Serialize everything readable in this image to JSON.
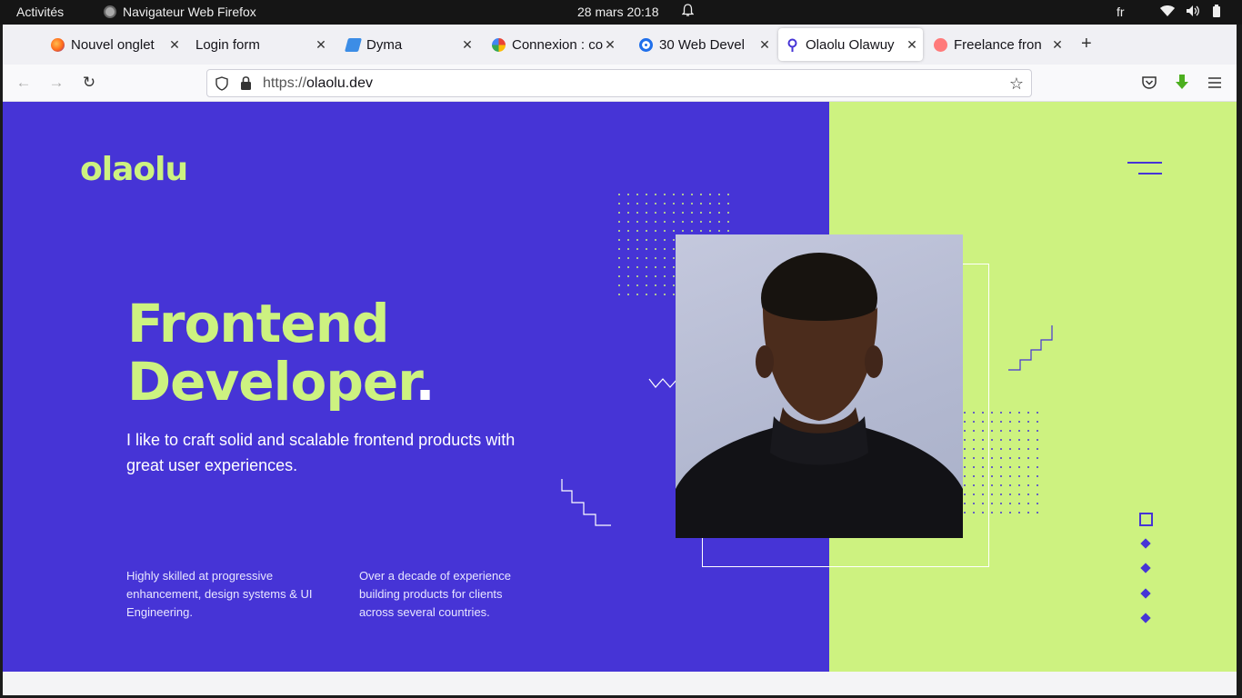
{
  "system_bar": {
    "activities": "Activités",
    "app_name": "Navigateur Web Firefox",
    "datetime": "28 mars  20:18",
    "lang": "fr"
  },
  "tabs": [
    {
      "label": "Nouvel onglet",
      "favicon_color": "#e66000",
      "active": false
    },
    {
      "label": "Login form",
      "favicon_color": "",
      "active": false
    },
    {
      "label": "Dyma",
      "favicon_color": "#3c8de6",
      "active": false
    },
    {
      "label": "Connexion : co",
      "favicon_color": "#4285f4",
      "active": false
    },
    {
      "label": "30 Web Devel",
      "favicon_color": "#1f6feb",
      "active": false
    },
    {
      "label": "Olaolu Olawuy",
      "favicon_color": "#4634d6",
      "active": true
    },
    {
      "label": "Freelance fron",
      "favicon_color": "#ff6b6b",
      "active": false
    }
  ],
  "new_tab": "+",
  "urlbar": {
    "scheme": "https://",
    "host": "olaolu.dev"
  },
  "page": {
    "logo": "olaolu",
    "title_line1": "Frontend",
    "title_line2": "Developer",
    "title_dot": ".",
    "subtitle": "I like to craft solid and scalable frontend products with great user experiences.",
    "feature1": "Highly skilled at progressive enhancement, design systems & UI Engineering.",
    "feature2": "Over a decade of experience building products for clients across several countries."
  },
  "colors": {
    "purple": "#4634d6",
    "lime": "#cdf280"
  }
}
